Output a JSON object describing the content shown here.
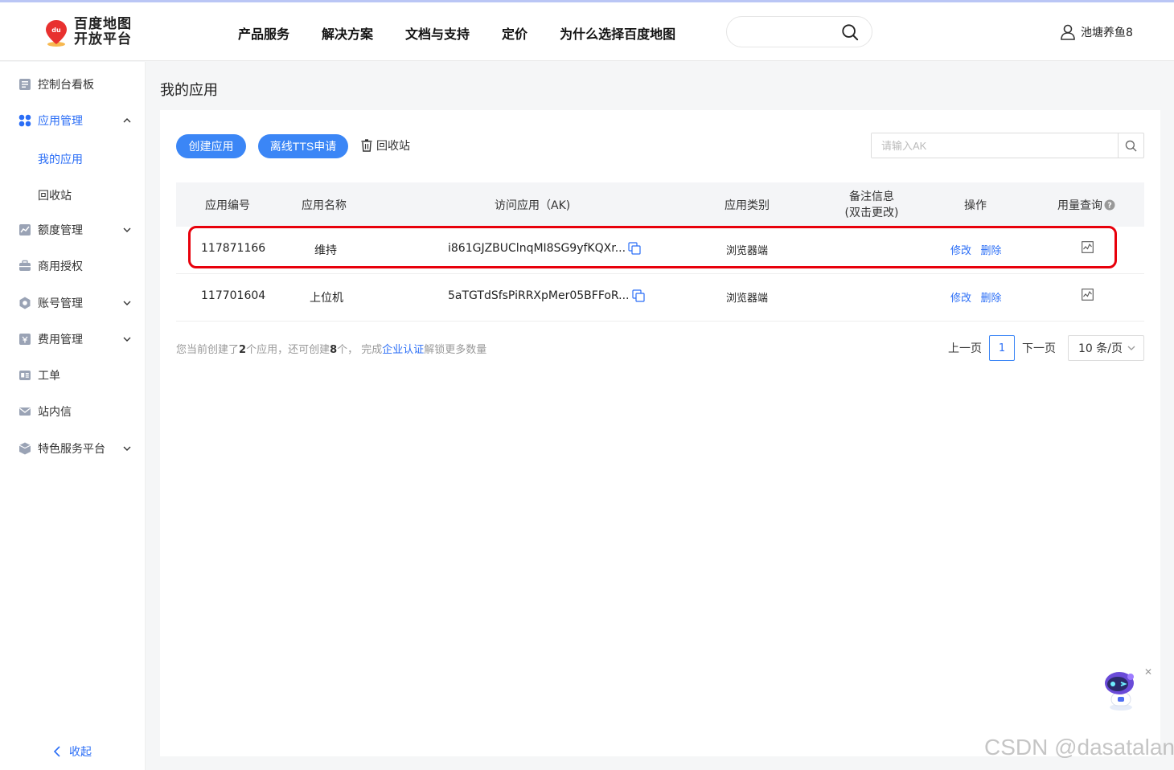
{
  "header": {
    "logo_line1": "百度地图",
    "logo_line2": "开放平台",
    "logo_badge": "du",
    "nav": [
      "产品服务",
      "解决方案",
      "文档与支持",
      "定价",
      "为什么选择百度地图"
    ],
    "search_placeholder": "",
    "username": "池塘养鱼8"
  },
  "sidebar": {
    "items": [
      {
        "label": "控制台看板",
        "icon": "dashboard-icon"
      },
      {
        "label": "应用管理",
        "icon": "apps-grid-icon"
      },
      {
        "label": "额度管理",
        "icon": "quota-chart-icon"
      },
      {
        "label": "商用授权",
        "icon": "briefcase-icon"
      },
      {
        "label": "账号管理",
        "icon": "gear-icon"
      },
      {
        "label": "费用管理",
        "icon": "billing-icon"
      },
      {
        "label": "工单",
        "icon": "ticket-icon"
      },
      {
        "label": "站内信",
        "icon": "mail-icon"
      },
      {
        "label": "特色服务平台",
        "icon": "cube-icon"
      }
    ],
    "sub_items": [
      "我的应用",
      "回收站"
    ],
    "collapse_label": "收起"
  },
  "main": {
    "title": "我的应用",
    "create_button": "创建应用",
    "tts_button": "离线TTS申请",
    "recycle_label": "回收站",
    "ak_placeholder": "请输入AK",
    "columns": [
      "应用编号",
      "应用名称",
      "访问应用（AK)",
      "应用类别",
      "备注信息",
      "(双击更改)",
      "操作",
      "用量查询"
    ],
    "rows": [
      {
        "id": "117871166",
        "name": "维持",
        "ak": "i861GJZBUClnqMI8SG9yfKQXr...",
        "type": "浏览器端",
        "note": "",
        "edit": "修改",
        "delete": "删除"
      },
      {
        "id": "117701604",
        "name": "上位机",
        "ak": "5aTGTdSfsPiRRXpMer05BFFoR...",
        "type": "浏览器端",
        "note": "",
        "edit": "修改",
        "delete": "删除"
      }
    ],
    "footer": {
      "t1": "您当前创建了",
      "n1": "2",
      "t2": "个应用，还可创建",
      "n2": "8",
      "t3": "个，  完成",
      "link": "企业认证",
      "t4": "解锁更多数量"
    },
    "pager": {
      "prev": "上一页",
      "page": "1",
      "next": "下一页",
      "size": "10 条/页"
    }
  },
  "watermark": "CSDN @dasatalan",
  "colors": {
    "accent": "#2b6ef6",
    "button": "#3b86f6",
    "highlight": "#e8000b"
  }
}
